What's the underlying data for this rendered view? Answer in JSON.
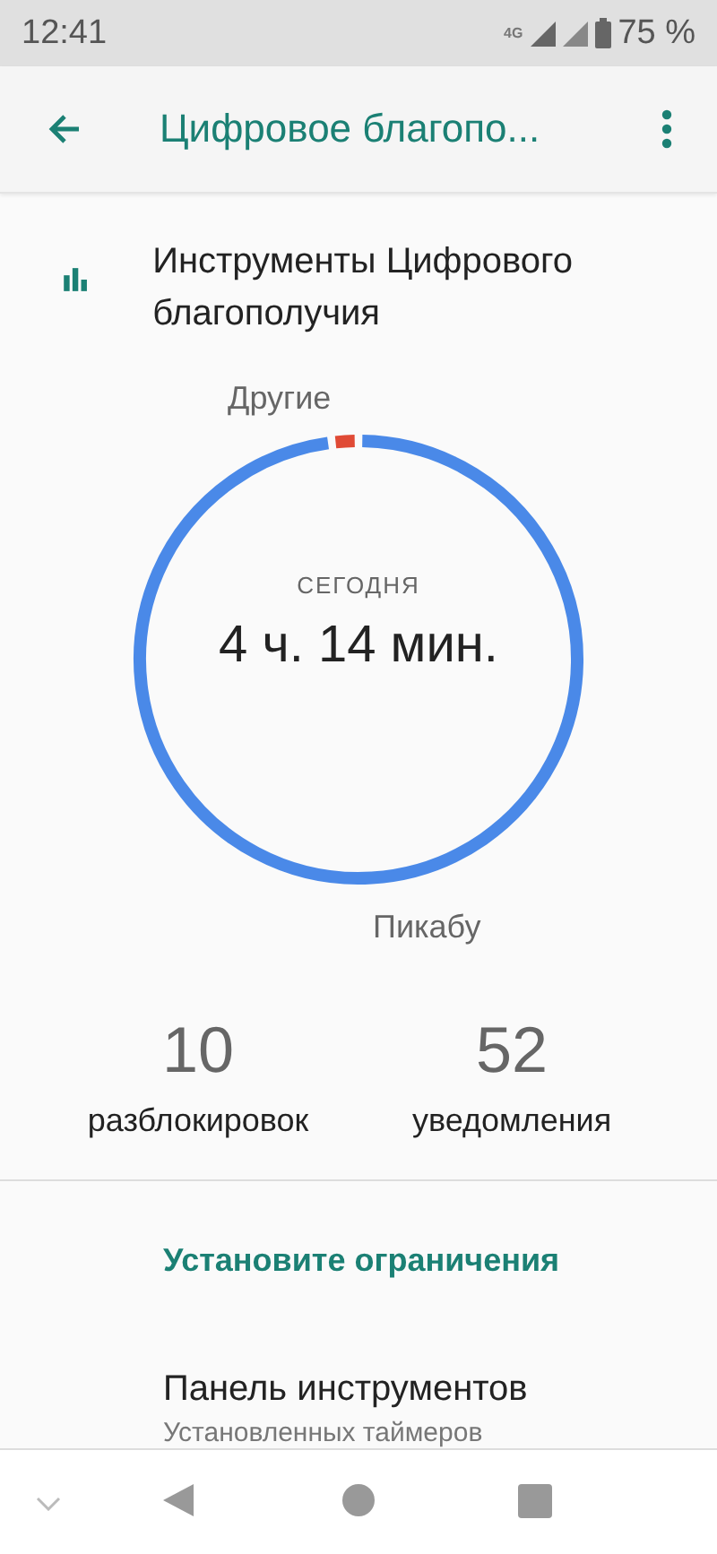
{
  "status_bar": {
    "time": "12:41",
    "network": "4G",
    "battery": "75 %"
  },
  "app_bar": {
    "title": "Цифровое благопо..."
  },
  "header": {
    "title": "Инструменты Цифрового благополучия"
  },
  "usage": {
    "caption": "СЕГОДНЯ",
    "total": "4 ч. 14 мин.",
    "segments": [
      {
        "label": "Другие",
        "color": "#e04a35"
      },
      {
        "label": "Пикабу",
        "color": "#4a89e8"
      }
    ]
  },
  "stats": [
    {
      "value": "10",
      "label": "разблокировок"
    },
    {
      "value": "52",
      "label": "уведомления"
    }
  ],
  "section": {
    "title": "Установите ограничения"
  },
  "items": [
    {
      "title": "Панель инструментов",
      "subtitle": "Установленных таймеров"
    }
  ]
}
